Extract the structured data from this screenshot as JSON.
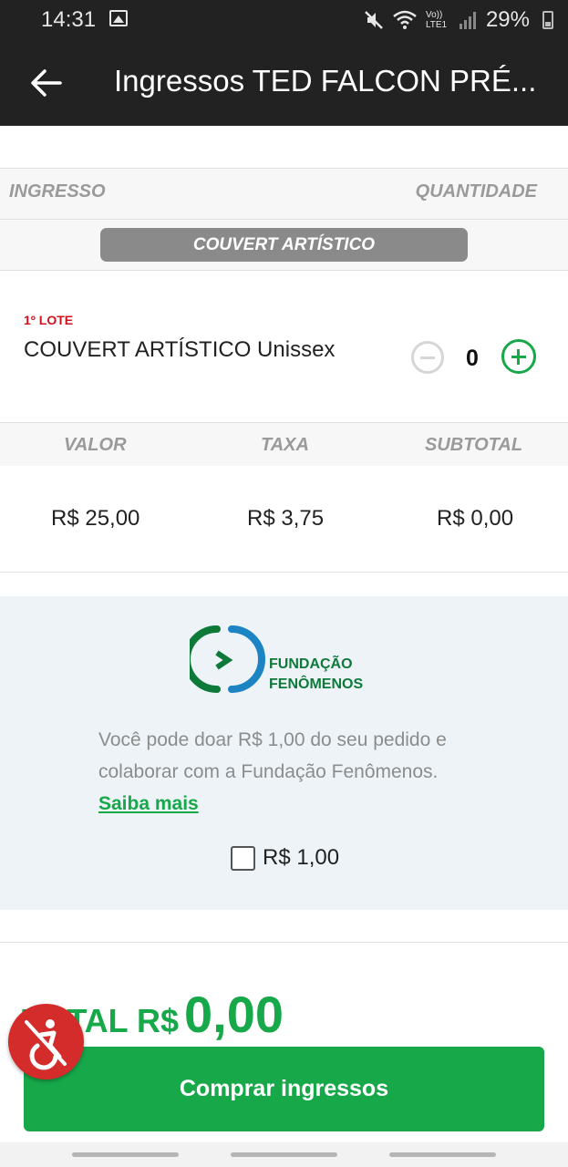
{
  "status_bar": {
    "time": "14:31",
    "network": "Vo)) LTE1",
    "battery": "29%",
    "icons": [
      "image-icon",
      "mute-icon",
      "wifi-icon",
      "signal-icon",
      "battery-icon"
    ]
  },
  "app_bar": {
    "title": "Ingressos TED FALCON PRÉ...",
    "back_icon": "arrow-left-icon"
  },
  "table_header": {
    "ingresso": "INGRESSO",
    "quantidade": "QUANTIDADE"
  },
  "category": {
    "label": "COUVERT ARTÍSTICO"
  },
  "ticket": {
    "lote": "1º LOTE",
    "name": "COUVERT ARTÍSTICO Unissex",
    "quantity": "0"
  },
  "price_header": {
    "valor": "VALOR",
    "taxa": "TAXA",
    "subtotal": "SUBTOTAL"
  },
  "prices": {
    "valor": "R$ 25,00",
    "taxa": "R$ 3,75",
    "subtotal": "R$ 0,00"
  },
  "donation": {
    "logo_line1": "FUNDAÇÃO",
    "logo_line2": "FENÔMENOS",
    "text": "Você pode doar R$ 1,00 do seu pedido e colaborar com a Fundação Fenômenos.",
    "link": "Saiba mais",
    "option": "R$ 1,00",
    "checked": false
  },
  "total": {
    "label": "TOTAL R$",
    "amount": "0,00"
  },
  "buy_button": "Comprar ingressos",
  "colors": {
    "primary": "#17a84a",
    "bar": "#222222",
    "accent_red": "#d0111d"
  }
}
